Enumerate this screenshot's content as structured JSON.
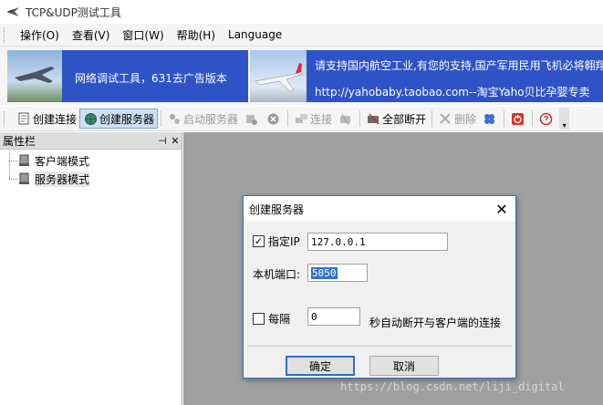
{
  "window": {
    "title": "TCP&UDP测试工具"
  },
  "menu": {
    "items": [
      "操作(O)",
      "查看(V)",
      "窗口(W)",
      "帮助(H)",
      "Language"
    ]
  },
  "banner": {
    "left_text": "网络调试工具，631去广告版本",
    "right_line1": "请支持国内航空工业,有您的支持,国产军用民用飞机必将翱翔",
    "right_line2": "http://yahobaby.taobao.com--淘宝Yaho贝比孕婴专卖"
  },
  "toolbar": {
    "create_connection": "创建连接",
    "create_server": "创建服务器",
    "start_server": "启动服务器",
    "connect": "连接",
    "disconnect_all": "全部断开",
    "delete": "删除"
  },
  "sidebar": {
    "title": "属性栏",
    "pin": "⊣",
    "close": "✕",
    "items": [
      {
        "label": "客户端模式"
      },
      {
        "label": "服务器模式"
      }
    ]
  },
  "dialog": {
    "title": "创建服务器",
    "specify_ip_label": "指定IP",
    "specify_ip_checked": "✓",
    "ip_value": "127.0.0.1",
    "port_label": "本机端口:",
    "port_value": "5050",
    "interval_label": "每隔",
    "interval_value": "0",
    "interval_suffix": "秒自动断开与客户端的连接",
    "ok_label": "确定",
    "cancel_label": "取消"
  },
  "watermark": "https://blog.csdn.net/liji_digital",
  "colors": {
    "accent": "#2f6fc6",
    "banner_blue": "#2e53c7",
    "workspace": "#a0a0a0"
  }
}
